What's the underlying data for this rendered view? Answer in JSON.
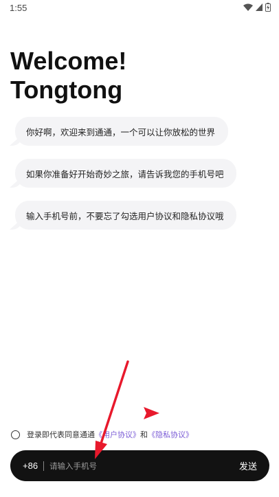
{
  "status_bar": {
    "time": "1:55"
  },
  "header": {
    "welcome_line1": "Welcome!",
    "welcome_line2": "Tongtong"
  },
  "messages": [
    "你好啊，欢迎来到通通，一个可以让你放松的世界",
    "如果你准备好开始奇妙之旅，请告诉我您的手机号吧",
    "输入手机号前，不要忘了勾选用户协议和隐私协议哦"
  ],
  "agreement": {
    "prefix": "登录即代表同意通通",
    "user_agreement": "《用户协议》",
    "connector": "和",
    "privacy_agreement": "《隐私协议》"
  },
  "phone": {
    "country_code": "+86",
    "placeholder": "请输入手机号",
    "value": "",
    "send_label": "发送"
  },
  "colors": {
    "bubble_bg": "#f4f4f6",
    "link": "#7b5cd6",
    "input_bar_bg": "#121212",
    "annotation_arrow": "#e8192c"
  },
  "icons": [
    "wifi-icon",
    "signal-icon",
    "battery-charging-icon"
  ]
}
